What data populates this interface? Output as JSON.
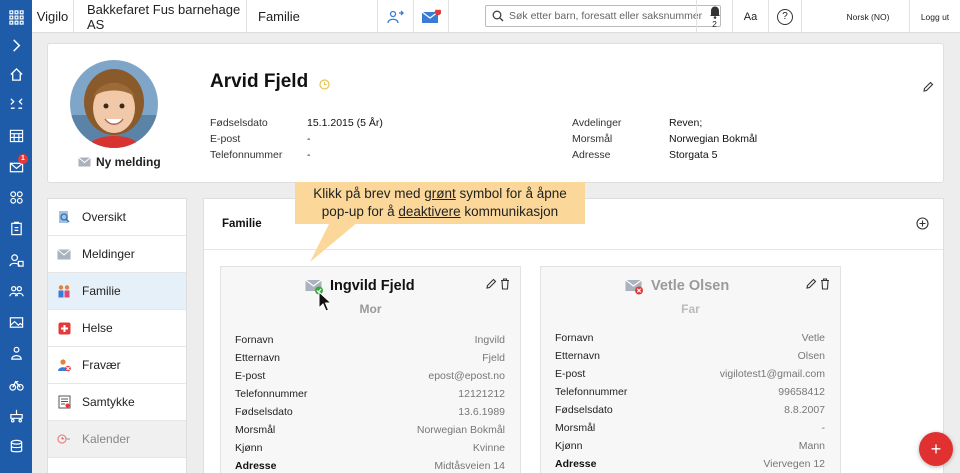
{
  "topbar": {
    "brand": "Vigilo",
    "org": "Bakkefaret Fus barnehage AS",
    "section": "Familie",
    "mail_badge": "1",
    "search_placeholder": "Søk etter barn, foresatt eller saksnummer",
    "bell_count": "2",
    "font_size_label": "Aa",
    "help_label": "?",
    "language": "Norsk (NO)",
    "logout": "Logg ut"
  },
  "leftnav": {
    "items": [
      "expand-icon",
      "home-icon",
      "checkin-icon",
      "calendar-icon",
      "mail-icon",
      "groups-icon",
      "clipboard-icon",
      "person-lock-icon",
      "people-icon",
      "gallery-icon",
      "child-icon",
      "bicycle-icon",
      "stroller-icon",
      "storage-icon"
    ],
    "mail_badge": "1"
  },
  "profile": {
    "name": "Arvid Fjeld",
    "new_message": "Ny melding",
    "left_info": [
      {
        "label": "Fødselsdato",
        "value": "15.1.2015 (5 År)"
      },
      {
        "label": "E-post",
        "value": "-"
      },
      {
        "label": "Telefonnummer",
        "value": "-"
      }
    ],
    "right_info": [
      {
        "label": "Avdelinger",
        "value": "Reven;"
      },
      {
        "label": "Morsmål",
        "value": "Norwegian Bokmål"
      },
      {
        "label": "Adresse",
        "value": "Storgata 5"
      }
    ]
  },
  "menu": [
    {
      "label": "Oversikt",
      "icon": "overview-icon"
    },
    {
      "label": "Meldinger",
      "icon": "messages-icon"
    },
    {
      "label": "Familie",
      "icon": "family-icon",
      "active": true
    },
    {
      "label": "Helse",
      "icon": "health-icon"
    },
    {
      "label": "Fravær",
      "icon": "absence-icon"
    },
    {
      "label": "Samtykke",
      "icon": "consent-icon"
    },
    {
      "label": "Kalender",
      "icon": "calendar-icon",
      "disabled": true
    }
  ],
  "family": {
    "title": "Familie",
    "callout": {
      "part1": "Klikk på brev med ",
      "u1": "grønt",
      "part2": " symbol for å åpne",
      "part3": "pop-up for å ",
      "u2": "deaktivere",
      "part4": " kommunikasjon"
    },
    "cards": [
      {
        "name": "Ingvild Fjeld",
        "role": "Mor",
        "status_color": "#3aa845",
        "rows": [
          {
            "k": "Fornavn",
            "v": "Ingvild"
          },
          {
            "k": "Etternavn",
            "v": "Fjeld"
          },
          {
            "k": "E-post",
            "v": "epost@epost.no"
          },
          {
            "k": "Telefonnummer",
            "v": "12121212"
          },
          {
            "k": "Fødselsdato",
            "v": "13.6.1989"
          },
          {
            "k": "Morsmål",
            "v": "Norwegian Bokmål"
          },
          {
            "k": "Kjønn",
            "v": "Kvinne"
          },
          {
            "k": "Adresse",
            "v": "Midtåsveien 14"
          }
        ]
      },
      {
        "name": "Vetle Olsen",
        "role": "Far",
        "status_color": "#e03a3a",
        "rows": [
          {
            "k": "Fornavn",
            "v": "Vetle"
          },
          {
            "k": "Etternavn",
            "v": "Olsen"
          },
          {
            "k": "E-post",
            "v": "vigilotest1@gmail.com"
          },
          {
            "k": "Telefonnummer",
            "v": "99658412"
          },
          {
            "k": "Fødselsdato",
            "v": "8.8.2007"
          },
          {
            "k": "Morsmål",
            "v": "-"
          },
          {
            "k": "Kjønn",
            "v": "Mann"
          },
          {
            "k": "Adresse",
            "v": "Viervegen 12"
          }
        ]
      }
    ]
  },
  "fab_label": "+"
}
